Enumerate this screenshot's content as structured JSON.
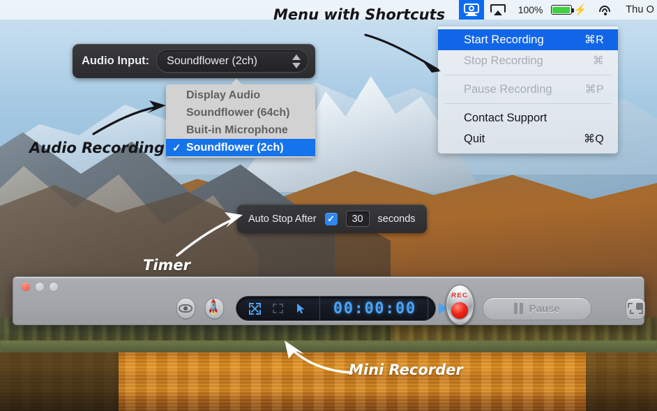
{
  "menubar": {
    "recorder_icon": "screen-recorder-icon",
    "airplay_icon": "airplay-icon",
    "battery_percent": "100%",
    "battery_icon": "battery-icon",
    "charging_icon": "bolt-icon",
    "wifi_icon": "wifi-icon",
    "clock": "Thu O"
  },
  "app_menu": {
    "items": [
      {
        "label": "Start Recording",
        "shortcut": "⌘R",
        "state": "selected"
      },
      {
        "label": "Stop Recording",
        "shortcut": "⌘",
        "state": "disabled"
      },
      {
        "label": "Pause Recording",
        "shortcut": "⌘P",
        "state": "disabled"
      },
      {
        "label": "Contact Support",
        "shortcut": "",
        "state": "normal"
      },
      {
        "label": "Quit",
        "shortcut": "⌘Q",
        "state": "normal"
      }
    ]
  },
  "audio_panel": {
    "label": "Audio Input:",
    "selected_value": "Soundflower (2ch)",
    "stepper_icon": "stepper-updown-icon"
  },
  "audio_options": {
    "items": [
      {
        "label": "Display Audio",
        "checked": false
      },
      {
        "label": "Soundflower (64ch)",
        "checked": false
      },
      {
        "label": "Buit-in Microphone",
        "checked": false
      },
      {
        "label": "Soundflower (2ch)",
        "checked": true
      }
    ],
    "check_glyph": "✓"
  },
  "timer_panel": {
    "label": "Auto Stop After",
    "checkbox_checked": true,
    "check_glyph": "✓",
    "seconds_value": "30",
    "unit_label": "seconds"
  },
  "mini_recorder": {
    "window_title": "",
    "traffic_lights": [
      "close",
      "minimize",
      "zoom"
    ],
    "preview_icon": "eye-icon",
    "launch_icon": "rocket-icon",
    "capture_modes": [
      {
        "icon": "fullscreen-arrows-icon",
        "active": true
      },
      {
        "icon": "crop-region-icon",
        "active": false
      },
      {
        "icon": "cursor-arrow-icon",
        "active": true
      }
    ],
    "timecode": "00:00:00",
    "play_icon": "play-icon",
    "stop_icon": "stop-icon",
    "record_label": "REC",
    "record_icon": "record-dot-icon",
    "pause_label": "Pause",
    "pause_icon": "pause-bars-icon",
    "screen_mode_icon": "window-select-icon"
  },
  "annotations": [
    {
      "text": "Menu with Shortcuts",
      "style": "dark"
    },
    {
      "text": "Audio Recording",
      "style": "dark"
    },
    {
      "text": "Timer",
      "style": "white"
    },
    {
      "text": "Mini Recorder",
      "style": "white"
    }
  ],
  "colors": {
    "menu_highlight": "#1166e8",
    "popup_highlight": "#1573ec",
    "menubar_active": "#0a6cf0",
    "checkbox_blue": "#2f86f3",
    "lcd_blue": "#4aa3f5",
    "record_red": "#f0241a",
    "battery_green": "#3ed23e"
  }
}
